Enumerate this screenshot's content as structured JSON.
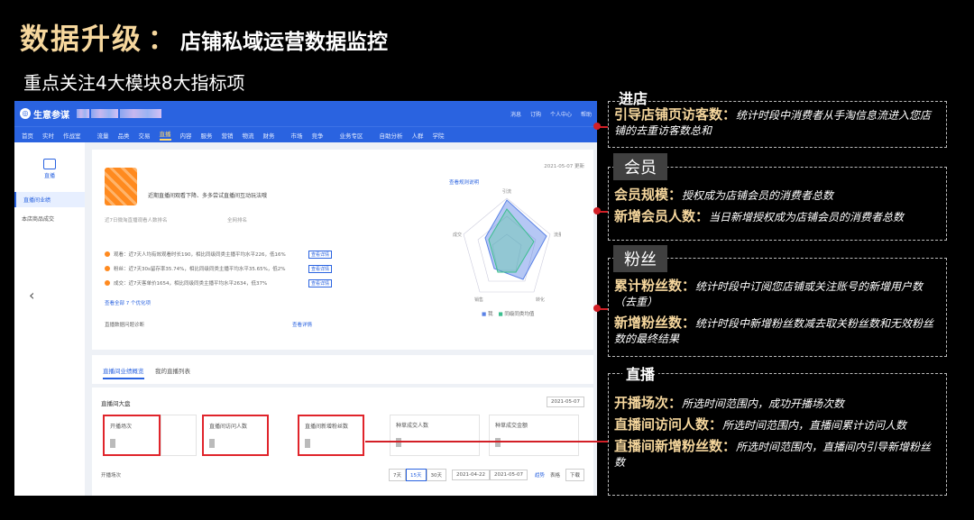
{
  "slide": {
    "title_main": "数据升级",
    "title_colon": "：",
    "title_sub": "店铺私域运营数据监控",
    "subtitle": "重点关注4大模块8大指标项"
  },
  "screenshot": {
    "app_name": "生意参谋",
    "topbar_right": [
      "消息",
      "订购",
      "个人中心",
      "帮助"
    ],
    "nav": [
      "首页",
      "实时",
      "作战室",
      "流量",
      "品类",
      "交易",
      "直播",
      "内容",
      "服务",
      "营销",
      "物流",
      "财务",
      "市场",
      "竞争",
      "业务专区",
      "自助分析",
      "人群",
      "学院"
    ],
    "nav_active": "直播",
    "sidebar_title": "直播",
    "sidebar_items": [
      "直播间业绩",
      "本店商品成交"
    ],
    "card_date": "2021-05-07 更新",
    "card_hint": "近期直播间观看下降、多多尝试直播间互动玩法哦",
    "label_left": "近7日微淘直播观看人数排名",
    "label_right": "全网排名",
    "alerts": [
      {
        "text": "观看：近7天人均有效观看时长190，相比同级同类主播平均水平226，低16%",
        "btn": "查看详情"
      },
      {
        "text": "粉丝：近7天30s留存率35.74%，相比同级同类主播平均水平35.65%，低2%",
        "btn": "查看详情"
      },
      {
        "text": "成交：近7天客单价1654，相比同级同类主播平均水平2634，低37%",
        "btn": "查看详情"
      }
    ],
    "more_link": "查看全部 7 个优化项",
    "diag_left": "直播数据问题诊断",
    "diag_right": "查看详情",
    "radar_link": "查看规则说明",
    "radar_axes": [
      "引流",
      "流量",
      "转化",
      "销售",
      "成交"
    ],
    "legend": [
      "我",
      "同级同类均值"
    ],
    "tabs": [
      "直播间业绩概览",
      "我的直播列表"
    ],
    "dash_title": "直播间大盘",
    "dash_date": "2021-05-07",
    "metrics": [
      "开播场次",
      "直播间访问人数",
      "直播间新增粉丝数",
      "种草成交人数",
      "种草成交金额"
    ],
    "range_label": "开播场次",
    "range_options": [
      "7天",
      "15天",
      "30天"
    ],
    "range_start": "2021-04-22",
    "range_end": "2021-05-07",
    "view_modes": [
      "趋势",
      "表格",
      "下载"
    ]
  },
  "annotations": {
    "jindian": {
      "title": "进店",
      "items": [
        {
          "label": "引导店铺页访客数",
          "sep": "：",
          "desc": "统计时段中消费者从手淘信息流进入您店铺的去重访客数总和"
        }
      ]
    },
    "huiyuan": {
      "title": "会员",
      "items": [
        {
          "label": "会员规模",
          "sep": "：",
          "desc": "授权成为店铺会员的消费者总数"
        },
        {
          "label": "新增会员人数",
          "sep": "：",
          "desc": "当日新增授权成为店铺会员的消费者总数"
        }
      ]
    },
    "fensi": {
      "title": "粉丝",
      "items": [
        {
          "label": "累计粉丝数",
          "sep": "：",
          "desc": "统计时段中订阅您店铺或关注账号的新增用户数（去重）"
        },
        {
          "label": "新增粉丝数",
          "sep": "：",
          "desc": "统计时段中新增粉丝数减去取关粉丝数和无效粉丝数的最终结果"
        }
      ]
    },
    "zhibo": {
      "title": "直播",
      "items": [
        {
          "label": "开播场次",
          "sep": "：",
          "desc": "所选时间范围内，成功开播场次数"
        },
        {
          "label": "直播间访问人数",
          "sep": "：",
          "desc": "所选时间范围内，直播间累计访问人数"
        },
        {
          "label": "直播间新增粉丝数",
          "sep": "：",
          "desc": "所选时间范围内，直播间内引导新增粉丝数"
        }
      ]
    }
  },
  "colors": {
    "title_gold": "#f6d79d",
    "brand_blue": "#2a63e0",
    "highlight_red": "#e0242b"
  }
}
